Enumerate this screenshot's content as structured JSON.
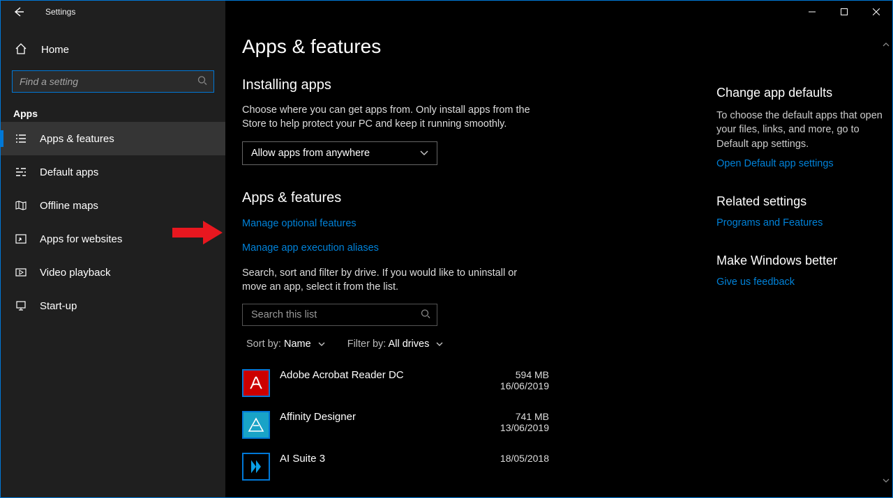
{
  "window": {
    "title": "Settings"
  },
  "sidebar": {
    "home": "Home",
    "search_placeholder": "Find a setting",
    "section": "Apps",
    "items": [
      {
        "label": "Apps & features",
        "active": true
      },
      {
        "label": "Default apps"
      },
      {
        "label": "Offline maps"
      },
      {
        "label": "Apps for websites"
      },
      {
        "label": "Video playback"
      },
      {
        "label": "Start-up"
      }
    ]
  },
  "main": {
    "title": "Apps & features",
    "installing": {
      "heading": "Installing apps",
      "description": "Choose where you can get apps from. Only install apps from the Store to help protect your PC and keep it running smoothly.",
      "dropdown_value": "Allow apps from anywhere"
    },
    "features": {
      "heading": "Apps & features",
      "link_optional": "Manage optional features",
      "link_aliases": "Manage app execution aliases",
      "description": "Search, sort and filter by drive. If you would like to uninstall or move an app, select it from the list.",
      "search_placeholder": "Search this list",
      "sort_label": "Sort by:",
      "sort_value": "Name",
      "filter_label": "Filter by:",
      "filter_value": "All drives",
      "apps": [
        {
          "name": "Adobe Acrobat Reader DC",
          "size": "594 MB",
          "date": "16/06/2019"
        },
        {
          "name": "Affinity Designer",
          "size": "741 MB",
          "date": "13/06/2019"
        },
        {
          "name": "AI Suite 3",
          "size": "",
          "date": "18/05/2018"
        }
      ]
    }
  },
  "side": {
    "defaults": {
      "heading": "Change app defaults",
      "description": "To choose the default apps that open your files, links, and more, go to Default app settings.",
      "link": "Open Default app settings"
    },
    "related": {
      "heading": "Related settings",
      "link": "Programs and Features"
    },
    "feedback": {
      "heading": "Make Windows better",
      "link": "Give us feedback"
    }
  }
}
